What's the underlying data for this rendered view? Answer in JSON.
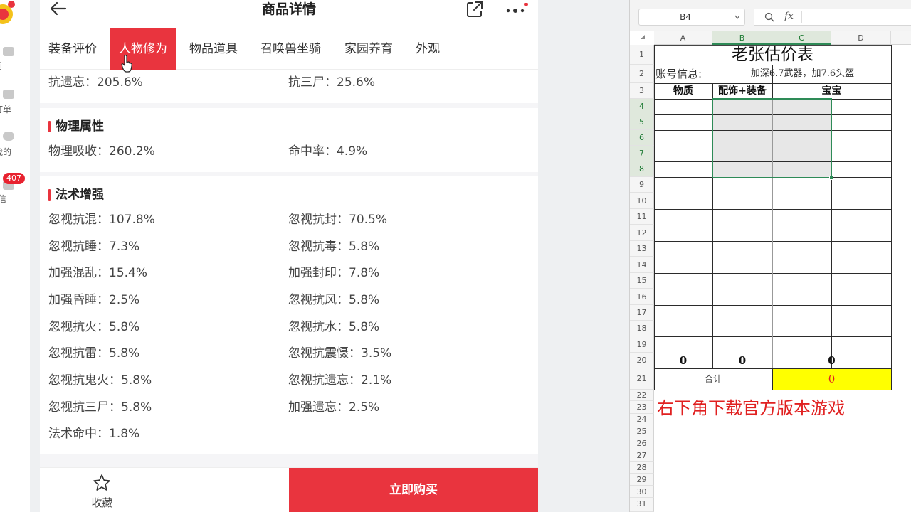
{
  "sidebar": {
    "items": [
      {
        "label": "首页",
        "icon": "home-icon"
      },
      {
        "label": "订单",
        "icon": "order-icon"
      },
      {
        "label": "我的",
        "icon": "user-icon"
      },
      {
        "label": "站内信",
        "icon": "message-icon"
      }
    ],
    "unread_count": "407"
  },
  "detail": {
    "title": "商品详情",
    "tabs": [
      "装备评价",
      "人物修为",
      "物品道具",
      "召唤兽坐骑",
      "家园养育",
      "外观"
    ],
    "active_tab": 1,
    "partial_section": {
      "attrs": [
        {
          "label": "抗遗忘：205.6%"
        },
        {
          "label": "抗三尸：25.6%"
        }
      ]
    },
    "physical": {
      "title": "物理属性",
      "attrs": [
        {
          "label": "物理吸收：260.2%"
        },
        {
          "label": "命中率：4.9%"
        }
      ]
    },
    "magic": {
      "title": "法术增强",
      "attrs": [
        {
          "label": "忽视抗混：107.8%"
        },
        {
          "label": "忽视抗封：70.5%"
        },
        {
          "label": "忽视抗睡：7.3%"
        },
        {
          "label": "忽视抗毒：5.8%"
        },
        {
          "label": "加强混乱：15.4%"
        },
        {
          "label": "加强封印：7.8%"
        },
        {
          "label": "加强昏睡：2.5%"
        },
        {
          "label": "忽视抗风：5.8%"
        },
        {
          "label": "忽视抗火：5.8%"
        },
        {
          "label": "忽视抗水：5.8%"
        },
        {
          "label": "忽视抗雷：5.8%"
        },
        {
          "label": "忽视抗震慑：3.5%"
        },
        {
          "label": "忽视抗鬼火：5.8%"
        },
        {
          "label": "忽视抗遗忘：2.1%"
        },
        {
          "label": "忽视抗三尸：5.8%"
        },
        {
          "label": "加强遗忘：2.5%"
        },
        {
          "label": "法术命中：1.8%"
        }
      ]
    },
    "bottom": {
      "favorite_label": "收藏",
      "buy_label": "立即购买"
    },
    "accent_color": "#e9343e"
  },
  "sheet": {
    "name_box": "B4",
    "fx_label": "fx",
    "columns": [
      "A",
      "B",
      "C",
      "D"
    ],
    "selected_columns": [
      "B",
      "C"
    ],
    "rows": [
      "1",
      "2",
      "3",
      "4",
      "5",
      "6",
      "7",
      "8",
      "9",
      "10",
      "11",
      "12",
      "13",
      "14",
      "15",
      "16",
      "17",
      "18",
      "19",
      "20",
      "21",
      "22",
      "23",
      "24",
      "25",
      "26",
      "27",
      "28",
      "29",
      "30",
      "31"
    ],
    "selected_rows": [
      "4",
      "5",
      "6",
      "7",
      "8"
    ],
    "title": "老张估价表",
    "account_label": "账号信息:",
    "account_value": "加深6.7武器，加7.6头盔",
    "header_quality": "物质",
    "header_gear": "配饰+装备",
    "header_pet": "宝宝",
    "sum_a": "0",
    "sum_b": "0",
    "sum_c": "0",
    "total_label": "合计",
    "total_value": "0",
    "notice": "右下角下载官方版本游戏",
    "total_fill": "#ffff00",
    "notice_color": "#e02020"
  }
}
